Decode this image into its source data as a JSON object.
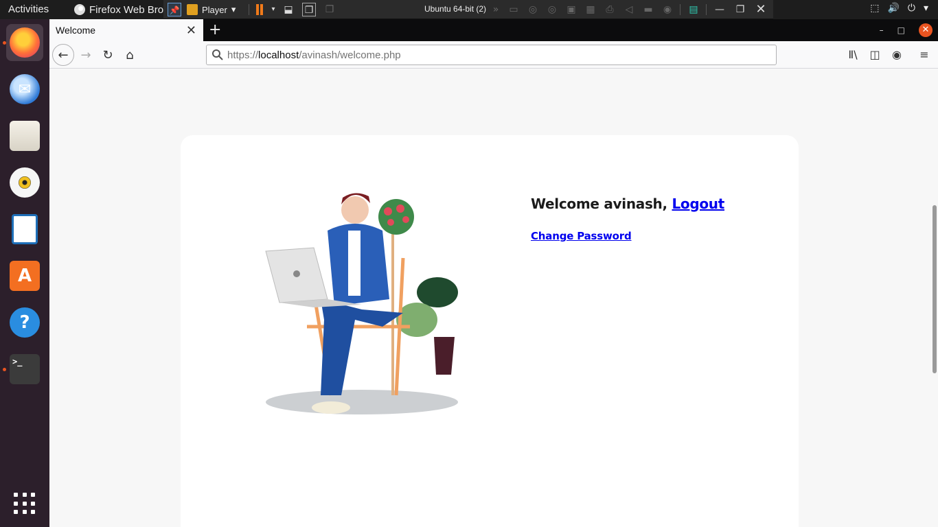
{
  "topbar": {
    "activities": "Activities",
    "app_name": "Firefox Web Browser"
  },
  "vmware": {
    "player_label": "Player",
    "vm_title": "Ubuntu 64-bit (2)"
  },
  "browser": {
    "tab_title": "Welcome",
    "url_prefix": "https://",
    "url_host": "localhost",
    "url_path": "/avinash/welcome.php"
  },
  "page": {
    "welcome_text": "Welcome avinash, ",
    "logout_label": "Logout",
    "change_password_label": "Change Password"
  },
  "colors": {
    "link": "#0000ee",
    "dock_bg": "#2c1f2b",
    "accent": "#e95420"
  }
}
